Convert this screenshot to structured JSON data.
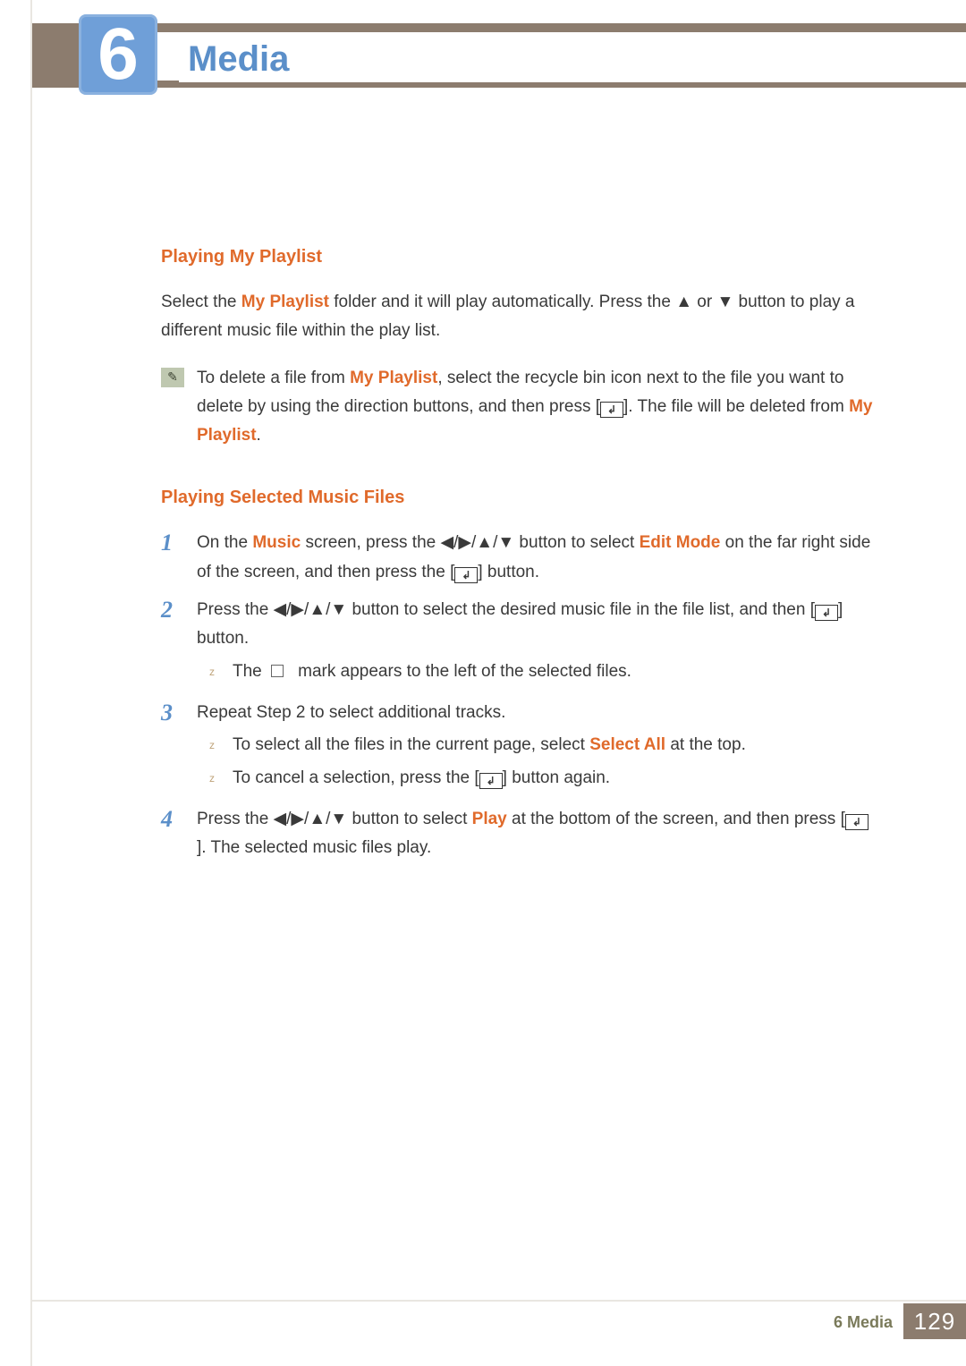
{
  "chapter": {
    "number": "6",
    "title": "Media"
  },
  "section1": {
    "heading": "Playing My Playlist",
    "intro_1": "Select the ",
    "intro_kw1": "My Playlist",
    "intro_2": " folder and it will play automatically. Press the ▲ or ▼ button to play a different music file within the play list.",
    "note_1": "To delete a file from ",
    "note_kw1": "My Playlist",
    "note_2": ", select the recycle bin icon next to the file you want to delete by using the direction buttons, and then press [",
    "note_3": "]. The file will be deleted from ",
    "note_kw2": "My Playlist",
    "note_4": "."
  },
  "section2": {
    "heading": "Playing Selected Music Files",
    "step1_a": "On the ",
    "step1_kw1": "Music",
    "step1_b": " screen, press the ◀/▶/▲/▼ button to select ",
    "step1_kw2": "Edit Mode",
    "step1_c": " on the far right side of the screen, and then press the [",
    "step1_d": "] button.",
    "step2_a": "Press the ◀/▶/▲/▼ button to select the desired music file in the file list, and then [",
    "step2_b": "] button.",
    "step2_sub1_a": "The ",
    "step2_sub1_b": " mark appears to the left of the selected files.",
    "step3": "Repeat Step 2 to select additional tracks.",
    "step3_sub1_a": "To select all the files in the current page, select ",
    "step3_sub1_kw": "Select All",
    "step3_sub1_b": " at the top.",
    "step3_sub2_a": "To cancel a selection, press the [",
    "step3_sub2_b": "] button again.",
    "step4_a": "Press the ◀/▶/▲/▼ button to select ",
    "step4_kw": "Play",
    "step4_b": " at the bottom of the screen, and then press [",
    "step4_c": "]. The selected music files play."
  },
  "footer": {
    "label": "6 Media",
    "page": "129"
  },
  "step_numbers": {
    "n1": "1",
    "n2": "2",
    "n3": "3",
    "n4": "4"
  },
  "bullet": "z"
}
